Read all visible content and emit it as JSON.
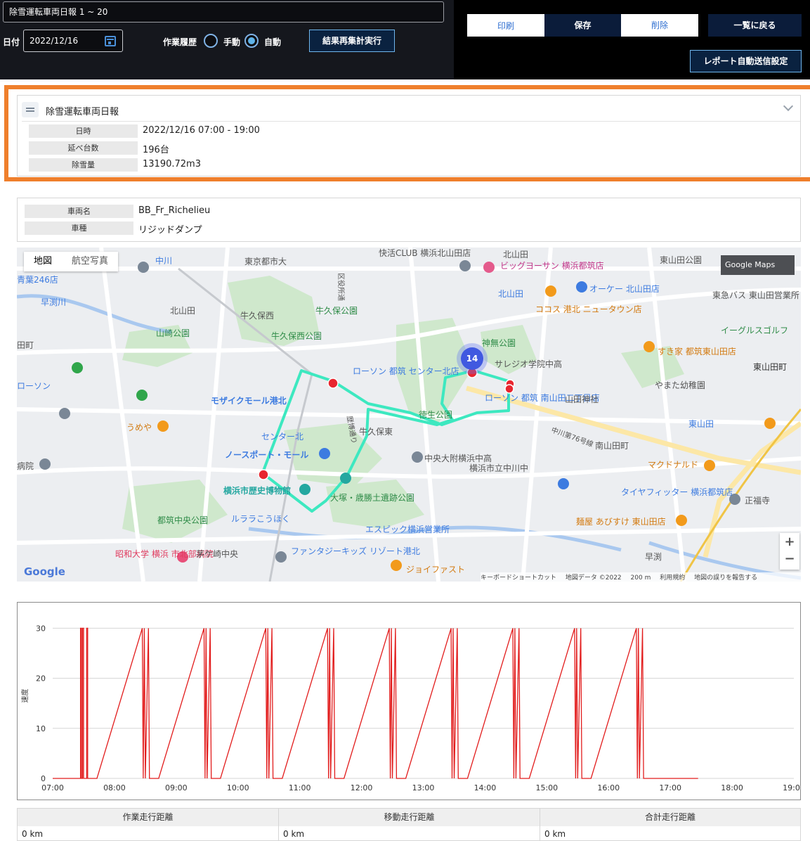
{
  "header": {
    "report_selector": "除雪運転車両日報 1 ~ 20",
    "date_label": "日付",
    "date_value": "2022/12/16",
    "history_label": "作業履歴",
    "manual_label": "手動",
    "auto_label": "自動",
    "selected_mode": "自動",
    "recalc_button": "結果再集計実行"
  },
  "actions": {
    "print": "印刷",
    "save": "保存",
    "delete": "削除",
    "back_to_list": "一覧に戻る",
    "auto_send": "レポート自動送信設定"
  },
  "report": {
    "title": "除雪運転車両日報",
    "rows": [
      {
        "label": "日時",
        "value": "2022/12/16 07:00 - 19:00"
      },
      {
        "label": "延べ台数",
        "value": "196台"
      },
      {
        "label": "除雪量",
        "value": "13190.72m3"
      }
    ]
  },
  "vehicle": {
    "rows": [
      {
        "label": "車両名",
        "value": "BB_Fr_Richelieu"
      },
      {
        "label": "車種",
        "value": "リジッドダンプ"
      }
    ]
  },
  "map": {
    "tab_map": "地図",
    "tab_aerial": "航空写真",
    "badge": "Google Maps",
    "cluster_count": "14",
    "google": "Google",
    "attribution": [
      "キーボードショートカット",
      "地図データ ©2022",
      "200 m",
      "利用規約",
      "地図の誤りを報告する"
    ],
    "zoom_in": "+",
    "zoom_out": "−",
    "labels": [
      "快活CLUB 横浜北山田店",
      "北山田",
      "ビッグヨーサン 横浜都筑店",
      "東山田公園",
      "東京都市大",
      "区役所通",
      "中川",
      "青葉246店",
      "早渕川",
      "牛久保西",
      "牛久保公園",
      "北山田",
      "オーケー 北山田店",
      "東急バス 東山田営業所",
      "ココス 港北 ニュータウン店",
      "山崎公園",
      "牛久保西公園",
      "神無公園",
      "イーグルスゴルフ",
      "すき家 都筑東山田店",
      "サレジオ学院中高",
      "ローソン 都筑 センター北店",
      "東山田町",
      "ローソン 都筑 南山田二丁目店",
      "やまた幼稚園",
      "モザイクモール港北",
      "徳生公園",
      "山田神社",
      "東山田",
      "センター北",
      "牛久保東",
      "中川第76号線",
      "南山田町",
      "ノースポート・モール",
      "中央大附横浜中高",
      "横浜市立中川中",
      "マクドナルド",
      "うめや",
      "横浜市歴史博物館",
      "大塚・歳勝土遺跡公園",
      "タイヤフィッター 横浜都筑店",
      "正福寺",
      "都筑中央公園",
      "ルララこうほく",
      "麺屋 あびすけ 東山田店",
      "エスピック横浜営業所",
      "昭和大学 横浜 市北部病院",
      "茅ケ崎中央",
      "ファンタジーキッズ リゾート港北",
      "早渕",
      "ジョイファスト",
      "歴博通り",
      "田町",
      "病院",
      "ローソン"
    ]
  },
  "chart_data": {
    "type": "line",
    "title": "",
    "xlabel": "",
    "ylabel": "速度",
    "x_ticks": [
      "07:00",
      "08:00",
      "09:00",
      "10:00",
      "11:00",
      "12:00",
      "13:00",
      "14:00",
      "15:00",
      "16:00",
      "17:00",
      "18:00",
      "19:00"
    ],
    "y_ticks": [
      0,
      10,
      20,
      30
    ],
    "ylim": [
      0,
      33
    ],
    "xlim": [
      "07:00",
      "19:00"
    ],
    "grid": true,
    "series": [
      {
        "color": "#e21c1c",
        "x": [
          "07:00",
          "07:27",
          "07:27",
          "07:28",
          "07:28",
          "07:29",
          "07:29",
          "07:30",
          "07:30",
          "07:33",
          "07:33",
          "07:34",
          "07:34",
          "07:42",
          "07:42",
          "07:43",
          "08:27",
          "08:27",
          "08:28",
          "08:28",
          "08:29",
          "08:29",
          "08:30",
          "08:30",
          "08:33",
          "08:33",
          "08:34",
          "08:34",
          "08:42",
          "08:42",
          "08:43",
          "09:27",
          "09:27",
          "09:28",
          "09:28",
          "09:29",
          "09:29",
          "09:30",
          "09:30",
          "09:33",
          "09:33",
          "09:34",
          "09:34",
          "09:42",
          "09:42",
          "09:43",
          "10:27",
          "10:27",
          "10:28",
          "10:28",
          "10:29",
          "10:29",
          "10:30",
          "10:30",
          "10:33",
          "10:33",
          "10:34",
          "10:34",
          "10:42",
          "10:42",
          "10:43",
          "11:27",
          "11:27",
          "11:28",
          "11:28",
          "11:29",
          "11:29",
          "11:30",
          "11:30",
          "11:33",
          "11:33",
          "11:34",
          "11:34",
          "11:42",
          "11:42",
          "11:43",
          "12:27",
          "12:27",
          "12:28",
          "12:28",
          "12:29",
          "12:29",
          "12:30",
          "12:30",
          "12:33",
          "12:33",
          "12:34",
          "12:34",
          "12:42",
          "12:42",
          "12:43",
          "13:27",
          "13:27",
          "13:28",
          "13:28",
          "13:29",
          "13:29",
          "13:30",
          "13:30",
          "13:33",
          "13:33",
          "13:34",
          "13:34",
          "13:42",
          "13:42",
          "13:43",
          "14:27",
          "14:27",
          "14:28",
          "14:28",
          "14:29",
          "14:29",
          "14:30",
          "14:30",
          "14:33",
          "14:33",
          "14:34",
          "14:34",
          "14:42",
          "14:42",
          "14:43",
          "15:27",
          "15:27",
          "15:28",
          "15:28",
          "15:29",
          "15:29",
          "15:30",
          "15:30",
          "15:33",
          "15:33",
          "15:34",
          "15:34",
          "15:42",
          "15:42",
          "15:43",
          "16:27",
          "16:27",
          "16:28",
          "16:28",
          "16:29",
          "16:29",
          "16:30",
          "16:30",
          "16:33",
          "16:33",
          "16:34",
          "16:34",
          "16:42",
          "16:42",
          "16:43",
          "17:27"
        ],
        "y": [
          0,
          0,
          30,
          30,
          0,
          0,
          30,
          30,
          0,
          0,
          30,
          30,
          0,
          0,
          0,
          0,
          30,
          30,
          0,
          0,
          30,
          30,
          0,
          0,
          30,
          30,
          0,
          0,
          0,
          0,
          0,
          30,
          30,
          0,
          0,
          30,
          30,
          0,
          0,
          30,
          30,
          0,
          0,
          0,
          0,
          0,
          30,
          30,
          0,
          0,
          30,
          30,
          0,
          0,
          30,
          30,
          0,
          0,
          0,
          0,
          0,
          30,
          30,
          0,
          0,
          30,
          30,
          0,
          0,
          30,
          30,
          0,
          0,
          0,
          0,
          0,
          30,
          30,
          0,
          0,
          30,
          30,
          0,
          0,
          30,
          30,
          0,
          0,
          0,
          0,
          0,
          30,
          30,
          0,
          0,
          30,
          30,
          0,
          0,
          30,
          30,
          0,
          0,
          0,
          0,
          0,
          30,
          30,
          0,
          0,
          30,
          30,
          0,
          0,
          30,
          30,
          0,
          0,
          0,
          0,
          0,
          30,
          30,
          0,
          0,
          30,
          30,
          0,
          0,
          30,
          30,
          0,
          0,
          0,
          0,
          0,
          30,
          30,
          0,
          0,
          30,
          30,
          0,
          0,
          30,
          30,
          0,
          0,
          0,
          0,
          0,
          0
        ]
      }
    ]
  },
  "distance": {
    "cols": [
      {
        "label": "作業走行距離",
        "value": "0 km"
      },
      {
        "label": "移動走行距離",
        "value": "0 km"
      },
      {
        "label": "合計走行距離",
        "value": "0 km"
      }
    ]
  },
  "colors": {
    "accent_orange": "#ef7f2c",
    "route": "#3de8c0",
    "stop_marker": "#e8262f",
    "cluster": "#4059e0",
    "speed_line": "#e21c1c"
  }
}
